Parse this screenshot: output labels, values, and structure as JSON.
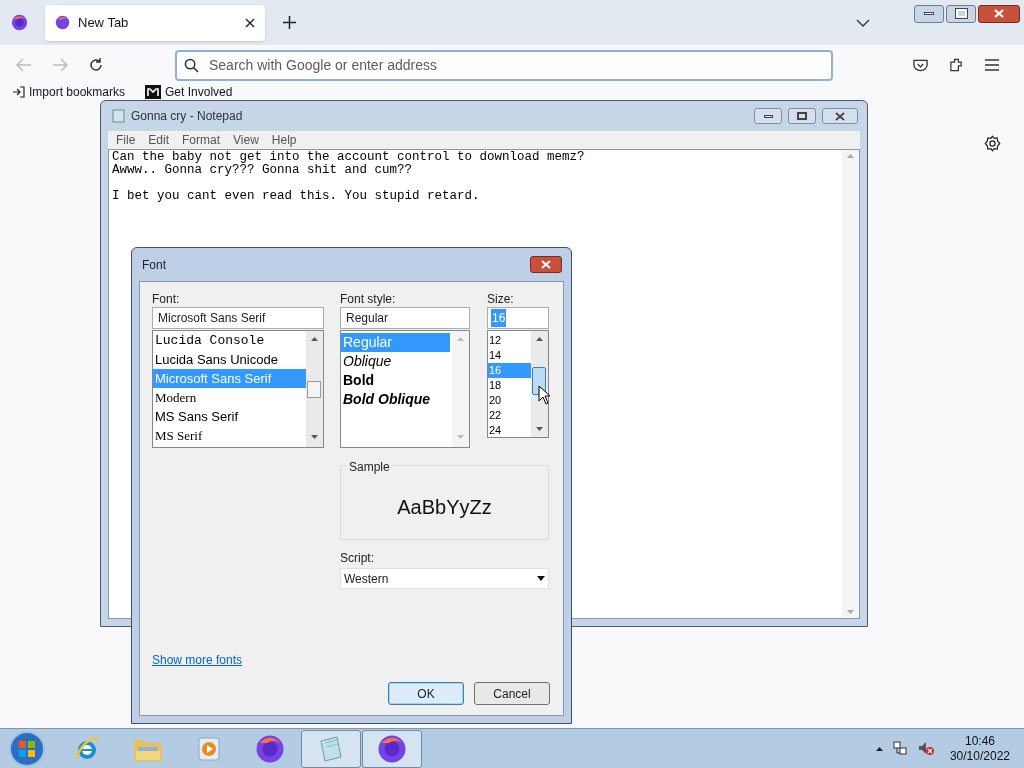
{
  "browser": {
    "tab": {
      "title": "New Tab",
      "selected": true
    },
    "address_bar": {
      "placeholder": "Search with Google or enter address"
    },
    "bookmarks": [
      {
        "label": "Import bookmarks",
        "kind": "import"
      },
      {
        "label": "Get Involved",
        "kind": "site"
      }
    ]
  },
  "notepad": {
    "title": "Gonna cry - Notepad",
    "menu": [
      "File",
      "Edit",
      "Format",
      "View",
      "Help"
    ],
    "text": "Can the baby not get into the account control to download memz?\nAwww.. Gonna cry??? Gonna shit and cum??\n\nI bet you cant even read this. You stupid retard."
  },
  "font_dialog": {
    "title": "Font",
    "font_label": "Font:",
    "font_value": "Microsoft Sans Serif",
    "fonts": [
      {
        "label": "Lucida Console",
        "kind": "mono",
        "selected": false
      },
      {
        "label": "Lucida Sans Unicode",
        "kind": "sans",
        "selected": false
      },
      {
        "label": "Microsoft Sans Serif",
        "kind": "sans",
        "selected": true
      },
      {
        "label": "Modern",
        "kind": "serif",
        "selected": false
      },
      {
        "label": "MS Sans Serif",
        "kind": "sans",
        "selected": false
      },
      {
        "label": "MS Serif",
        "kind": "serif",
        "selected": false
      }
    ],
    "style_label": "Font style:",
    "style_value": "Regular",
    "styles": [
      {
        "label": "Regular",
        "kind": "regular",
        "selected": true
      },
      {
        "label": "Oblique",
        "kind": "oblique",
        "selected": false
      },
      {
        "label": "Bold",
        "kind": "bold",
        "selected": false
      },
      {
        "label": "Bold Oblique",
        "kind": "bold_oblique",
        "selected": false
      }
    ],
    "size_label": "Size:",
    "size_value": "16",
    "sizes": [
      {
        "label": "12",
        "selected": false
      },
      {
        "label": "14",
        "selected": false
      },
      {
        "label": "16",
        "selected": true
      },
      {
        "label": "18",
        "selected": false
      },
      {
        "label": "20",
        "selected": false
      },
      {
        "label": "22",
        "selected": false
      },
      {
        "label": "24",
        "selected": false
      }
    ],
    "sample_label": "Sample",
    "sample_text": "AaBbYyZz",
    "script_label": "Script:",
    "script_value": "Western",
    "link": "Show more fonts",
    "buttons": [
      {
        "label": "OK",
        "kind": "default"
      },
      {
        "label": "Cancel",
        "kind": "normal"
      }
    ]
  },
  "taskbar": {
    "items": [
      {
        "kind": "ie",
        "active": false
      },
      {
        "kind": "folder",
        "active": false
      },
      {
        "kind": "media",
        "active": false
      },
      {
        "kind": "firefox",
        "active": false
      },
      {
        "kind": "notepad",
        "active": true
      },
      {
        "kind": "firefox",
        "active": true
      }
    ],
    "time": "10:46",
    "date": "30/10/2022"
  }
}
